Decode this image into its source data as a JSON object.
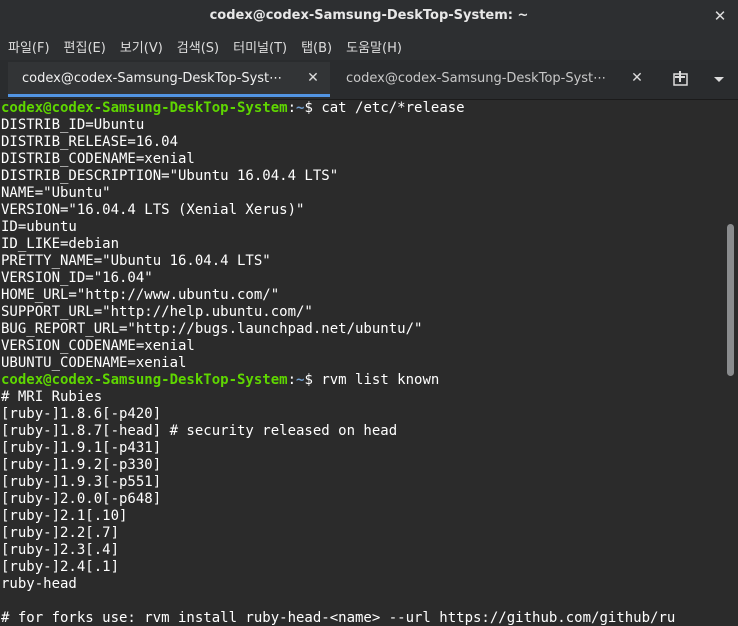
{
  "window": {
    "title": "codex@codex-Samsung-DeskTop-System: ~"
  },
  "menu": {
    "items": [
      "파일(F)",
      "편집(E)",
      "보기(V)",
      "검색(S)",
      "터미널(T)",
      "탭(B)",
      "도움말(H)"
    ]
  },
  "tabs": [
    {
      "label": "codex@codex-Samsung-DeskTop-Syst⋯",
      "active": true
    },
    {
      "label": "codex@codex-Samsung-DeskTop-Syst⋯",
      "active": false
    }
  ],
  "icons": {
    "window_close": "close-icon",
    "tab_close": "close-icon",
    "new_tab": "new-tab-icon",
    "tab_menu": "chevron-down-icon"
  },
  "colors": {
    "prompt_user": "#5fd700",
    "prompt_path": "#729fcf",
    "background": "#2b2b2b",
    "foreground": "#ffffff",
    "tab_accent": "#5294e2"
  },
  "terminal": {
    "lines": [
      {
        "type": "prompt",
        "user": "codex@codex-Samsung-DeskTop-System",
        "path": "~",
        "command": "cat /etc/*release"
      },
      {
        "type": "output",
        "text": "DISTRIB_ID=Ubuntu"
      },
      {
        "type": "output",
        "text": "DISTRIB_RELEASE=16.04"
      },
      {
        "type": "output",
        "text": "DISTRIB_CODENAME=xenial"
      },
      {
        "type": "output",
        "text": "DISTRIB_DESCRIPTION=\"Ubuntu 16.04.4 LTS\""
      },
      {
        "type": "output",
        "text": "NAME=\"Ubuntu\""
      },
      {
        "type": "output",
        "text": "VERSION=\"16.04.4 LTS (Xenial Xerus)\""
      },
      {
        "type": "output",
        "text": "ID=ubuntu"
      },
      {
        "type": "output",
        "text": "ID_LIKE=debian"
      },
      {
        "type": "output",
        "text": "PRETTY_NAME=\"Ubuntu 16.04.4 LTS\""
      },
      {
        "type": "output",
        "text": "VERSION_ID=\"16.04\""
      },
      {
        "type": "output",
        "text": "HOME_URL=\"http://www.ubuntu.com/\""
      },
      {
        "type": "output",
        "text": "SUPPORT_URL=\"http://help.ubuntu.com/\""
      },
      {
        "type": "output",
        "text": "BUG_REPORT_URL=\"http://bugs.launchpad.net/ubuntu/\""
      },
      {
        "type": "output",
        "text": "VERSION_CODENAME=xenial"
      },
      {
        "type": "output",
        "text": "UBUNTU_CODENAME=xenial"
      },
      {
        "type": "prompt",
        "user": "codex@codex-Samsung-DeskTop-System",
        "path": "~",
        "command": "rvm list known"
      },
      {
        "type": "output",
        "text": "# MRI Rubies"
      },
      {
        "type": "output",
        "text": "[ruby-]1.8.6[-p420]"
      },
      {
        "type": "output",
        "text": "[ruby-]1.8.7[-head] # security released on head"
      },
      {
        "type": "output",
        "text": "[ruby-]1.9.1[-p431]"
      },
      {
        "type": "output",
        "text": "[ruby-]1.9.2[-p330]"
      },
      {
        "type": "output",
        "text": "[ruby-]1.9.3[-p551]"
      },
      {
        "type": "output",
        "text": "[ruby-]2.0.0[-p648]"
      },
      {
        "type": "output",
        "text": "[ruby-]2.1[.10]"
      },
      {
        "type": "output",
        "text": "[ruby-]2.2[.7]"
      },
      {
        "type": "output",
        "text": "[ruby-]2.3[.4]"
      },
      {
        "type": "output",
        "text": "[ruby-]2.4[.1]"
      },
      {
        "type": "output",
        "text": "ruby-head"
      },
      {
        "type": "output",
        "text": ""
      },
      {
        "type": "output",
        "text": "# for forks use: rvm install ruby-head-<name> --url https://github.com/github/ru"
      }
    ]
  },
  "scrollbar": {
    "position_fraction": 0.24,
    "visible_fraction": 0.29
  }
}
